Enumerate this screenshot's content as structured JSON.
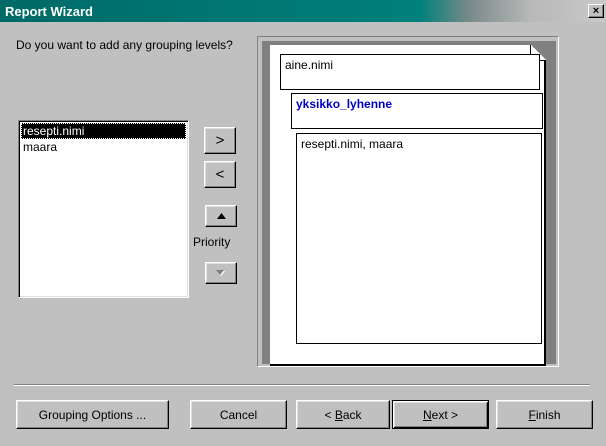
{
  "window": {
    "title": "Report Wizard",
    "close_label": "×"
  },
  "question": "Do you want to add any grouping levels?",
  "fields_list": {
    "items": [
      "resepti.nimi",
      "maara"
    ],
    "selected_index": 0
  },
  "move_buttons": {
    "add": ">",
    "remove": "<"
  },
  "priority_label": "Priority",
  "preview": {
    "level1": "aine.nimi",
    "level2": "yksikko_lyhenne",
    "detail": "resepti.nimi, maara"
  },
  "footer": {
    "grouping_options": "Grouping Options ...",
    "cancel": "Cancel",
    "back_prefix": "< ",
    "back_accel": "B",
    "back_rest": "ack",
    "next_accel": "N",
    "next_rest": "ext >",
    "finish_accel": "F",
    "finish_rest": "inish"
  },
  "colors": {
    "titlebar": "#00807c",
    "level2_text": "#0000c0",
    "selection": "#000000"
  }
}
